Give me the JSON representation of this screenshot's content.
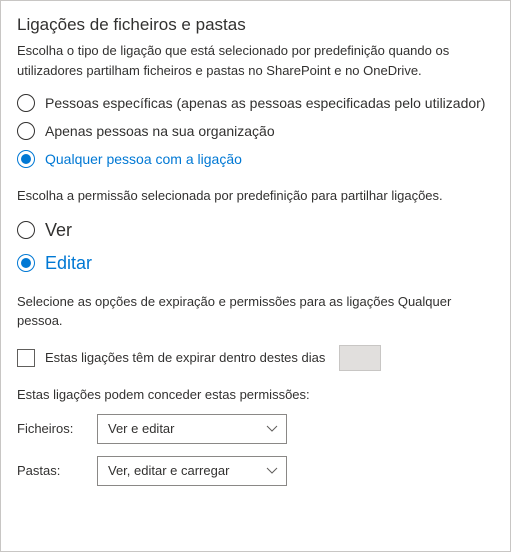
{
  "section": {
    "title": "Ligações de ficheiros e pastas",
    "description": "Escolha o tipo de ligação que está selecionado por predefinição quando os utilizadores partilham ficheiros e pastas no SharePoint e no OneDrive."
  },
  "link_type": {
    "options": [
      {
        "label": "Pessoas específicas (apenas as pessoas especificadas pelo utilizador)",
        "selected": false
      },
      {
        "label": "Apenas pessoas na sua organização",
        "selected": false
      },
      {
        "label": "Qualquer pessoa com a ligação",
        "selected": true
      }
    ]
  },
  "permission": {
    "description": "Escolha a permissão selecionada por predefinição para partilhar ligações.",
    "options": [
      {
        "label": "Ver",
        "selected": false
      },
      {
        "label": "Editar",
        "selected": true
      }
    ]
  },
  "expiration": {
    "description": "Selecione as opções de expiração e permissões para as ligações Qualquer pessoa.",
    "checkbox_label": "Estas ligações têm de expirar dentro destes dias",
    "days_value": ""
  },
  "permissions_section": {
    "label": "Estas ligações podem conceder estas permissões:",
    "files_label": "Ficheiros:",
    "files_value": "Ver e editar",
    "folders_label": "Pastas:",
    "folders_value": "Ver, editar e carregar"
  }
}
